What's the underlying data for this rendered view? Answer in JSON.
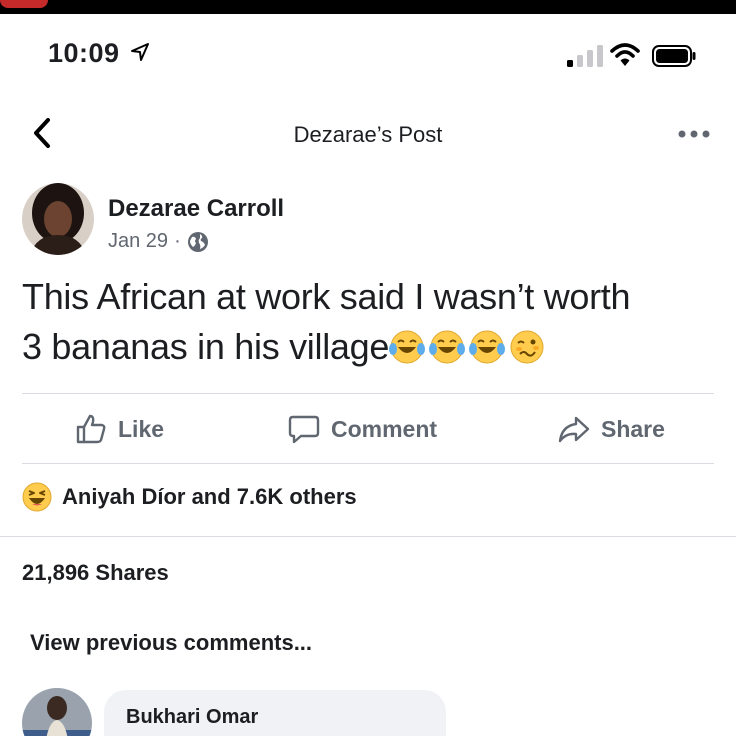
{
  "status_bar": {
    "time": "10:09",
    "icons": [
      "location-arrow-icon",
      "cellular-signal-icon",
      "wifi-icon",
      "battery-icon"
    ]
  },
  "nav": {
    "title": "Dezarae’s Post",
    "back_icon": "chevron-left-icon",
    "more_icon": "more-horizontal-icon"
  },
  "post": {
    "author": "Dezarae Carroll",
    "date": "Jan 29",
    "separator": "·",
    "privacy_icon": "globe-icon",
    "text_line1": "This African at work said I wasn’t worth",
    "text_line2": "3 bananas in his village",
    "emojis": [
      "tears-of-joy-emoji",
      "tears-of-joy-emoji",
      "tears-of-joy-emoji",
      "woozy-face-emoji"
    ]
  },
  "actions": {
    "like": "Like",
    "comment": "Comment",
    "share": "Share"
  },
  "reactions": {
    "icon": "haha-reaction-icon",
    "summary": "Aniyah Díor and 7.6K others"
  },
  "shares_count": "21,896 Shares",
  "view_previous": "View previous comments...",
  "comment": {
    "author": "Bukhari Omar"
  },
  "colors": {
    "text_primary": "#1c1e21",
    "text_secondary": "#606770",
    "divider": "#dadde1",
    "bubble": "#f0f2f5",
    "emoji_yellow": "#ffcc4d",
    "tear_blue": "#5dadec"
  }
}
